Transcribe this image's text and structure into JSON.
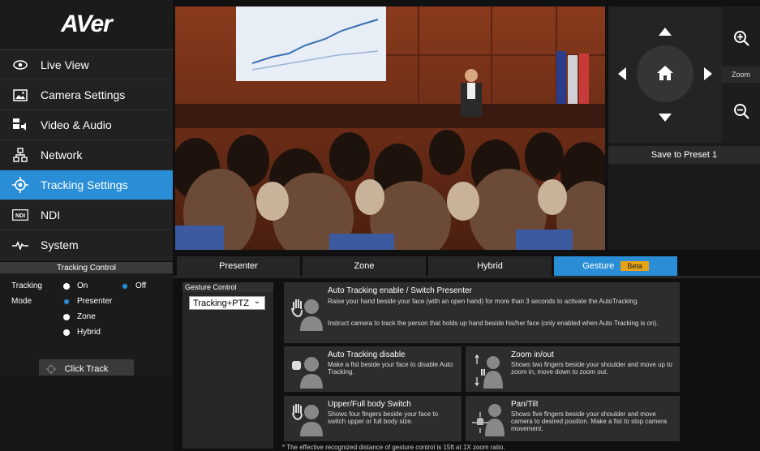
{
  "app": {
    "logo": "AVer"
  },
  "sidebar": {
    "items": [
      {
        "label": "Live View",
        "icon": "eye-icon",
        "active": false
      },
      {
        "label": "Camera Settings",
        "icon": "image-icon",
        "active": false
      },
      {
        "label": "Video & Audio",
        "icon": "video-audio-icon",
        "active": false
      },
      {
        "label": "Network",
        "icon": "network-icon",
        "active": false
      },
      {
        "label": "Tracking Settings",
        "icon": "crosshair-icon",
        "active": true
      },
      {
        "label": "NDI",
        "icon": "ndi-icon",
        "active": false
      },
      {
        "label": "System",
        "icon": "pulse-icon",
        "active": false
      }
    ]
  },
  "tracking_control": {
    "title": "Tracking Control",
    "tracking_label": "Tracking",
    "tracking_options": [
      {
        "label": "On",
        "selected": false
      },
      {
        "label": "Off",
        "selected": true
      }
    ],
    "mode_label": "Mode",
    "mode_options": [
      {
        "label": "Presenter",
        "selected": true
      },
      {
        "label": "Zone",
        "selected": false
      },
      {
        "label": "Hybrid",
        "selected": false
      }
    ],
    "click_track_label": "Click Track"
  },
  "ptz": {
    "zoom_label": "Zoom",
    "save_preset_label": "Save to Preset 1"
  },
  "tabs": [
    {
      "label": "Presenter",
      "active": false
    },
    {
      "label": "Zone",
      "active": false
    },
    {
      "label": "Hybrid",
      "active": false
    },
    {
      "label": "Gesture",
      "active": true,
      "badge": "Beta"
    }
  ],
  "gesture_control": {
    "title": "Gesture Control",
    "select_value": "Tracking+PTZ"
  },
  "gestures": {
    "enable": {
      "title": "Auto Tracking enable / Switch Presenter",
      "desc1": "Raise your hand beside your face (with an open hand) for more than 3 seconds to activate the AutoTracking.",
      "desc2": "Instruct camera to track the person that holds up hand beside his/her face (only enabled when Auto Tracking is on)."
    },
    "disable": {
      "title": "Auto Tracking disable",
      "desc": "Make a fist beside your face to disable Auto Tracking."
    },
    "zoom": {
      "title": "Zoom in/out",
      "desc": "Shows two fingers beside your shoulder and move up to zoom in, move down to zoom out."
    },
    "body": {
      "title": "Upper/Full body Switch",
      "desc": "Shows four fingers beside your face to switch upper or full body size."
    },
    "pantilt": {
      "title": "Pan/Tilt",
      "desc": "Shows five fingers beside your shoulder and move camera to desired position. Make a fist to stop camera movement."
    }
  },
  "footnote": "* The effective recognized distance of gesture control is 15ft at 1X zoom ratio.",
  "colors": {
    "accent": "#2a8ed6",
    "beta": "#e8a316",
    "sidebar_bg": "#1b1b1b"
  }
}
